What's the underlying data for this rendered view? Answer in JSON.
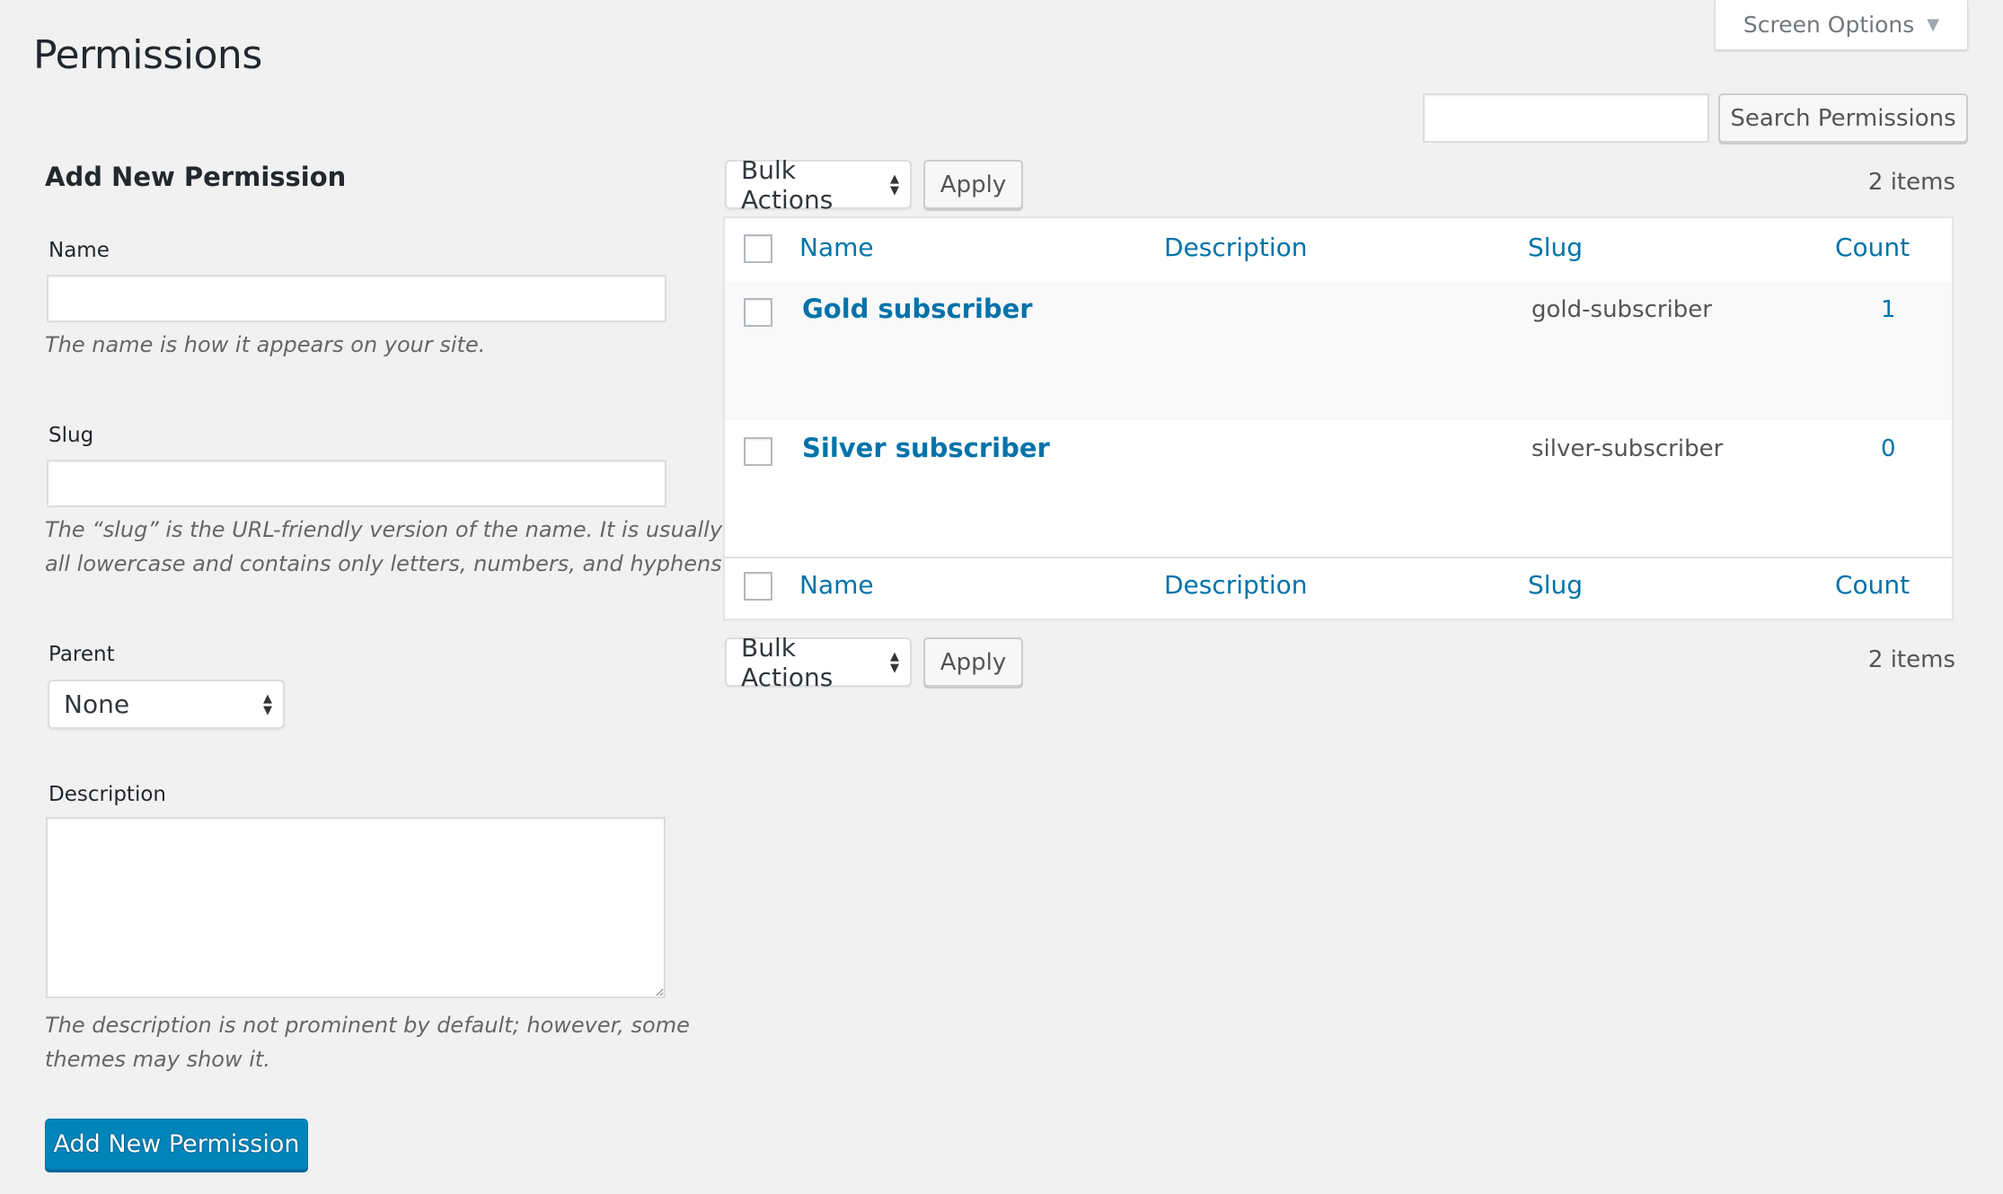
{
  "page": {
    "title": "Permissions",
    "screen_options_label": "Screen Options",
    "screen_options_icon": "triangle-down-icon"
  },
  "search": {
    "value": "",
    "placeholder": "",
    "button_label": "Search Permissions"
  },
  "form": {
    "heading": "Add New Permission",
    "name": {
      "label": "Name",
      "value": "",
      "help": "The name is how it appears on your site."
    },
    "slug": {
      "label": "Slug",
      "value": "",
      "help_line1": "The “slug” is the URL-friendly version of the name. It is usually",
      "help_line2": "all lowercase and contains only letters, numbers, and hyphens."
    },
    "parent": {
      "label": "Parent",
      "selected": "None"
    },
    "description": {
      "label": "Description",
      "value": "",
      "help_line1": "The description is not prominent by default; however, some",
      "help_line2": "themes may show it."
    },
    "submit_label": "Add New Permission"
  },
  "tablenav_top": {
    "bulk_actions": "Bulk Actions",
    "apply_label": "Apply",
    "items_count": "2 items"
  },
  "tablenav_bottom": {
    "bulk_actions": "Bulk Actions",
    "apply_label": "Apply",
    "items_count": "2 items"
  },
  "table": {
    "columns": [
      "Name",
      "Description",
      "Slug",
      "Count"
    ],
    "rows": [
      {
        "name": "Gold subscriber",
        "description": "",
        "slug": "gold-subscriber",
        "count": "1"
      },
      {
        "name": "Silver subscriber",
        "description": "",
        "slug": "silver-subscriber",
        "count": "0"
      }
    ]
  },
  "colors": {
    "link": "#0073aa",
    "primary_button": "#0085ba",
    "background": "#f1f1f1"
  }
}
